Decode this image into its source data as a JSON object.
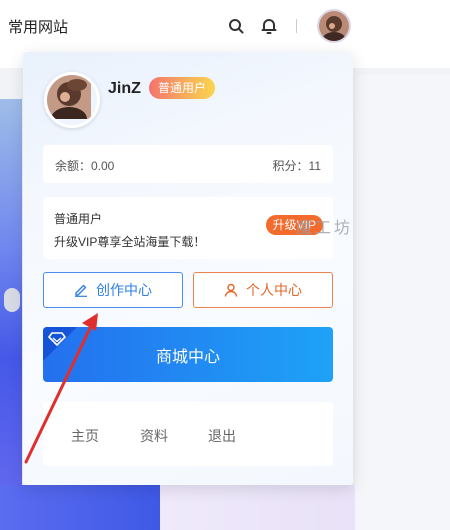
{
  "header": {
    "site_title": "常用网站",
    "search_icon": "search-icon",
    "bell_icon": "bell-icon"
  },
  "user": {
    "name": "JinZ",
    "badge": "普通用户"
  },
  "account": {
    "balance": "余额：0.00",
    "points": "积分：11"
  },
  "vip": {
    "title": "普通用户",
    "description": "升级VIP尊享全站海量下载！",
    "upgrade_label": "升级VIP"
  },
  "actions": {
    "create_center": "创作中心",
    "personal_center": "个人中心",
    "mall_center": "商城中心"
  },
  "nav": {
    "home": "主页",
    "profile": "资料",
    "logout": "退出"
  },
  "watermark": "魔工坊",
  "colors": {
    "primary_blue": "#2f7fe8",
    "orange": "#f26a2c",
    "annotation_red": "#e02e2e"
  }
}
